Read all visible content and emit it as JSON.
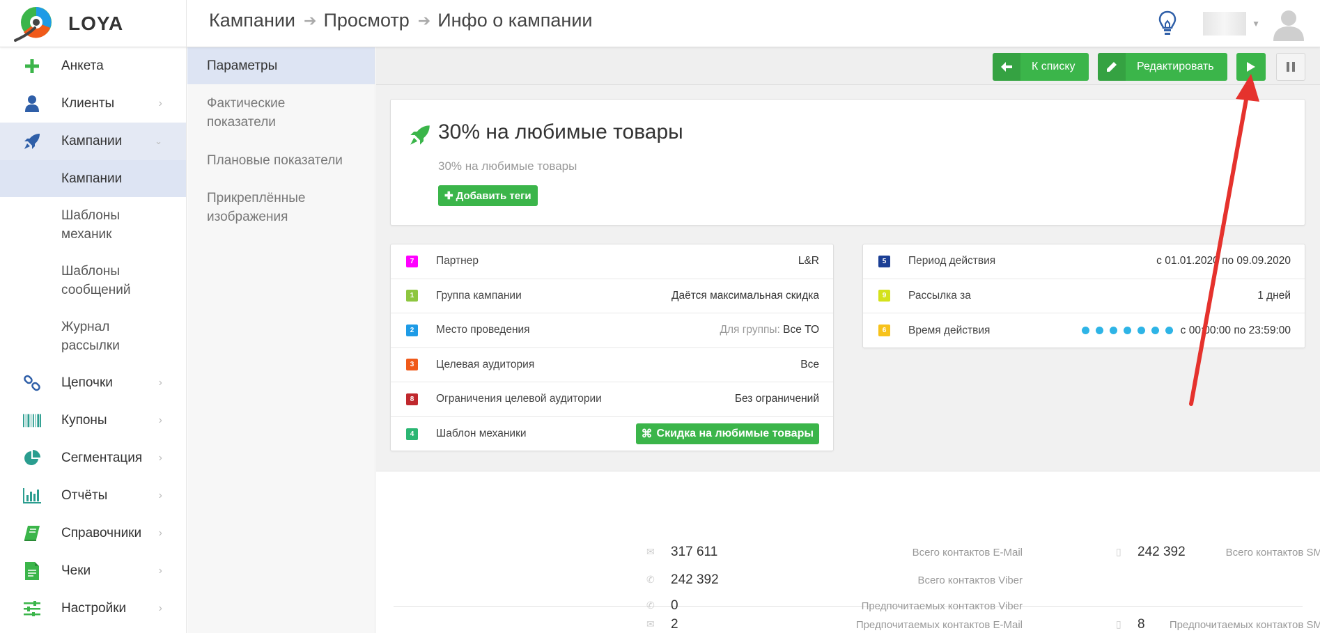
{
  "app": {
    "name": "LOYA"
  },
  "breadcrumbs": [
    "Кампании",
    "Просмотр",
    "Инфо о кампании"
  ],
  "sidebar": {
    "items": [
      {
        "label": "Анкета",
        "icon": "plus-icon",
        "color": "#3bb54a",
        "chevron": false
      },
      {
        "label": "Клиенты",
        "icon": "user-icon",
        "color": "#2f5fa8",
        "chevron": true
      },
      {
        "label": "Кампании",
        "icon": "rocket-icon",
        "color": "#2f5fa8",
        "chevron": true,
        "expanded": true
      }
    ],
    "subitems": [
      "Кампании",
      "Шаблоны механик",
      "Шаблоны сообщений",
      "Журнал рассылки"
    ],
    "items_after": [
      {
        "label": "Цепочки",
        "icon": "chain-icon",
        "color": "#2f5fa8"
      },
      {
        "label": "Купоны",
        "icon": "barcode-icon",
        "color": "#2a9d8f"
      },
      {
        "label": "Сегментация",
        "icon": "pie-icon",
        "color": "#2a9d8f"
      },
      {
        "label": "Отчёты",
        "icon": "bar-chart-icon",
        "color": "#2a9d8f"
      },
      {
        "label": "Справочники",
        "icon": "book-icon",
        "color": "#3bb54a"
      },
      {
        "label": "Чеки",
        "icon": "receipt-icon",
        "color": "#3bb54a"
      },
      {
        "label": "Настройки",
        "icon": "sliders-icon",
        "color": "#3bb54a"
      }
    ]
  },
  "subnav": {
    "items": [
      "Параметры",
      "Фактические показатели",
      "Плановые показатели",
      "Прикреплённые изображения"
    ]
  },
  "toolbar": {
    "back_label": "К списку",
    "edit_label": "Редактировать"
  },
  "campaign": {
    "title": "30% на любимые товары",
    "subtitle": "30% на любимые товары",
    "add_tags_label": "Добавить теги"
  },
  "params_left": [
    {
      "badge": "7",
      "badge_color": "#ff00ff",
      "label": "Партнер",
      "value": "L&R"
    },
    {
      "badge": "1",
      "badge_color": "#8dc63f",
      "label": "Группа кампании",
      "value": "Даётся максимальная скидка"
    },
    {
      "badge": "2",
      "badge_color": "#1e9be6",
      "label": "Место проведения",
      "value_muted": "Для группы:",
      "value": "Все ТО"
    },
    {
      "badge": "3",
      "badge_color": "#f05a1a",
      "label": "Целевая аудитория",
      "value": "Все"
    },
    {
      "badge": "8",
      "badge_color": "#c0282d",
      "label": "Ограничения целевой аудитории",
      "value": "Без ограничений"
    },
    {
      "badge": "4",
      "badge_color": "#2bb673",
      "label": "Шаблон механики",
      "value": "Скидка на любимые товары"
    }
  ],
  "params_right": [
    {
      "badge": "5",
      "badge_color": "#1b3f95",
      "label": "Период действия",
      "value": "с 01.01.2020 по 09.09.2020"
    },
    {
      "badge": "9",
      "badge_color": "#d4e21b",
      "label": "Рассылка за",
      "value": "1 дней"
    },
    {
      "badge": "6",
      "badge_color": "#f7c21b",
      "label": "Время действия",
      "value": "с 00:00:00 по 23:59:00"
    }
  ],
  "stats": {
    "email_total_label": "Всего контактов E-Mail",
    "email_total": "317 611",
    "viber_total_label": "Всего контактов Viber",
    "viber_total": "242 392",
    "sms_total_label": "Всего контактов SMS",
    "sms_total": "242 392",
    "email_pref_label": "Предпочитаемых контактов E-Mail",
    "email_pref": "2",
    "viber_pref_label": "Предпочитаемых контактов Viber",
    "viber_pref": "0",
    "sms_pref_label": "Предпочитаемых контактов SMS",
    "sms_pref": "8"
  },
  "colors": {
    "accent_green": "#3bb54a",
    "annotation_red": "#e5322d",
    "active_nav": "#e4e9f4"
  }
}
